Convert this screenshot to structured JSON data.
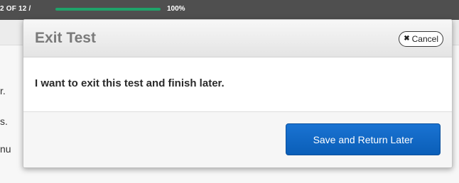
{
  "top_bar": {
    "question_counter": "2 OF 12  /",
    "progress_percent": "100%",
    "progress_value": 1.0,
    "progress_color": "#1fa36a"
  },
  "background_text": {
    "line1": "r.",
    "line2": "s.",
    "line3": "nu"
  },
  "modal": {
    "title": "Exit Test",
    "cancel_label": "Cancel",
    "cancel_icon": "close-icon",
    "message": "I want to exit this test and finish later.",
    "primary_button": "Save and Return Later",
    "primary_color": "#0a62c0"
  }
}
